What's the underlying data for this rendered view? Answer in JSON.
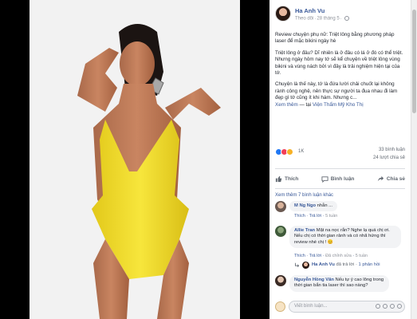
{
  "colors": {
    "link": "#385898",
    "text": "#1d2129",
    "muted": "#90949c",
    "swimsuit": "#f2e02a",
    "background": "#000000"
  },
  "post": {
    "author": "Ha Anh Vu",
    "audience_label": "Theo dõi",
    "date": "28 tháng 5",
    "paragraphs": [
      "Review chuyện phụ nữ: Triệt lông bằng phương pháp laser để mặc bikini ngày hè",
      "Triệt lông ở đâu? Dĩ nhiên là ở đâu có lá ở đó có thể triệt. Nhưng ngày hôm nay tớ sẽ kể chuyện về triệt lông vùng bikini và vùng nách bởi vì đây là trải nghiệm hiện tại của tớ.",
      "Chuyện là thế này, tớ là đứa lười chải chuốt lại không rành công nghệ, nên thực sự người ta đua nhau đi làm đẹp gì tớ cũng ít khi hám. Nhưng c..."
    ],
    "see_more": "Xem thêm",
    "tag_separator": " — tại ",
    "tag_place": "Viện Thẩm Mỹ Kho Thị"
  },
  "reactions": {
    "icons": [
      "like-icon",
      "love-icon",
      "wow-icon"
    ],
    "count": "1K",
    "comments": "33 bình luận",
    "shares": "24 lượt chia sẻ"
  },
  "actions": {
    "like": "Thích",
    "comment": "Bình luận",
    "share": "Chia sẻ"
  },
  "comments": {
    "more_label": "Xem thêm 7 bình luận khác",
    "items": [
      {
        "name": "M Ng Ngo",
        "text": "nhẫn ...",
        "like": "Thích",
        "reply": "Trả lời",
        "time": "5 tuần"
      },
      {
        "name": "Allie Tran",
        "text": "Mặt na nọc rắn? Nghe lạ quá chị ơi. Nếu chị có thời gian rảnh và có nhã hứng thì review nhé chị ! 😊",
        "like": "Thích",
        "reply": "Trả lời",
        "edited": "Đã chỉnh sửa",
        "time": "5 tuần"
      },
      {
        "reply_author": "Ha Anh Vu",
        "reply_label": "đã trả lời",
        "reply_count": "1 phản hồi"
      },
      {
        "name": "Nguyễn Hồng Vân",
        "text": "Nếu tự ý cao lông trong thời gian bắn tia laser thì sao nàng?",
        "like": "Thích",
        "reply": "Trả lời",
        "time": "5 tuần"
      }
    ]
  },
  "write_comment": {
    "placeholder": "Viết bình luận..."
  }
}
